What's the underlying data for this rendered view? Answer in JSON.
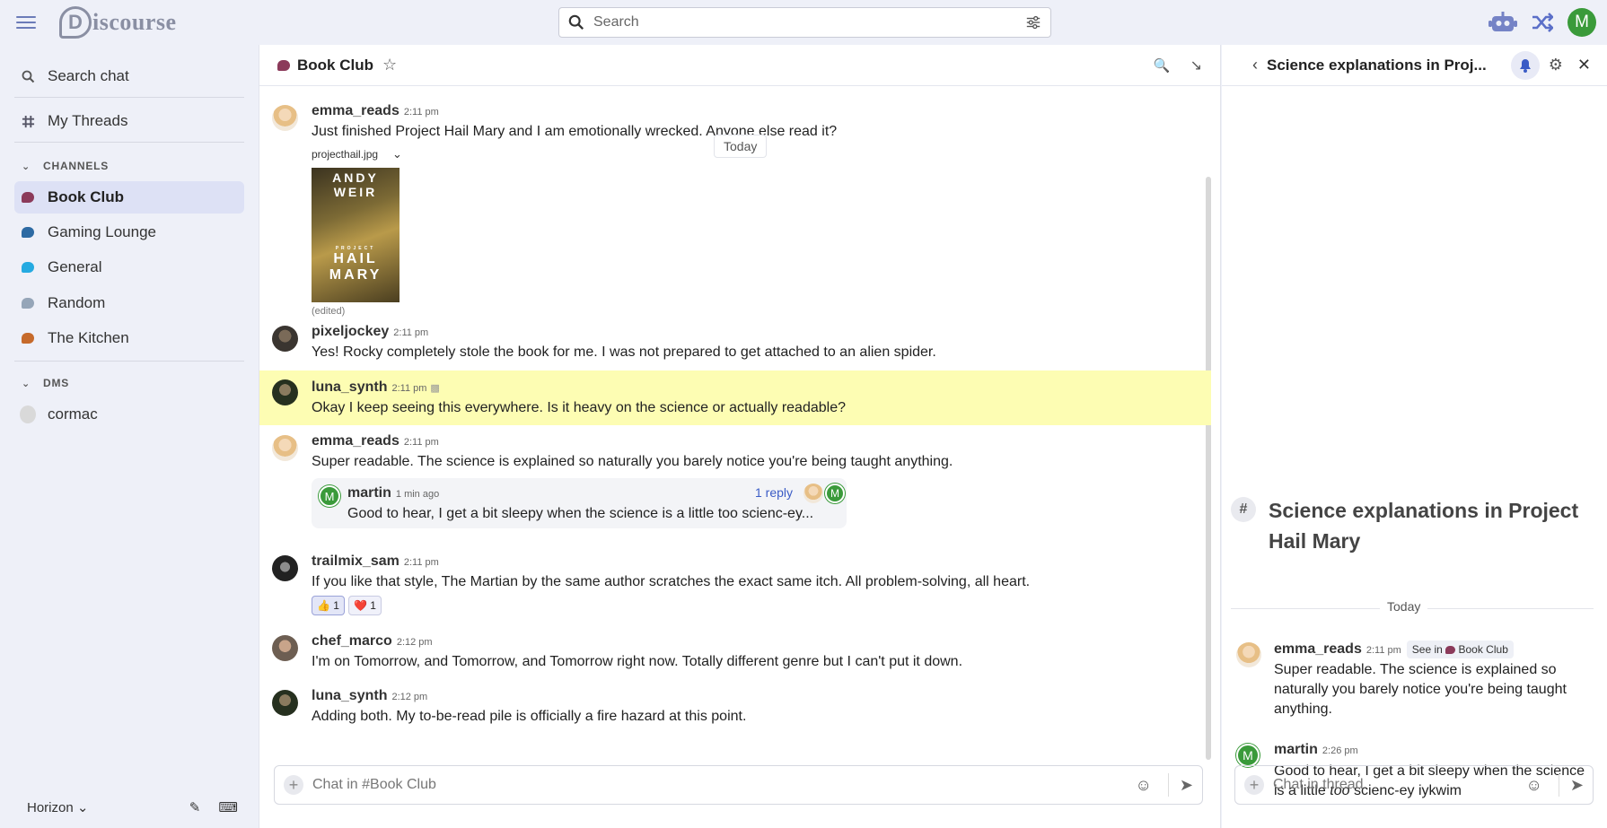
{
  "header": {
    "search_placeholder": "Search",
    "user_initial": "M"
  },
  "sidebar": {
    "search_chat": "Search chat",
    "my_threads": "My Threads",
    "channels_label": "CHANNELS",
    "channels": [
      {
        "label": "Book Club",
        "color": "#8b3a5a"
      },
      {
        "label": "Gaming Lounge",
        "color": "#2d6aa3"
      },
      {
        "label": "General",
        "color": "#25aae1"
      },
      {
        "label": "Random",
        "color": "#95a5b8"
      },
      {
        "label": "The Kitchen",
        "color": "#c66a2b"
      }
    ],
    "dms_label": "DMS",
    "dms": [
      {
        "label": "cormac"
      }
    ],
    "footer_theme": "Horizon"
  },
  "channel": {
    "title": "Book Club",
    "today": "Today",
    "messages": [
      {
        "user": "emma_reads",
        "time": "2:11 pm",
        "text": "Just finished Project Hail Mary and I am emotionally wrecked. Anyone else read it?",
        "attachment": "projecthail.jpg",
        "edited": "(edited)"
      },
      {
        "user": "pixeljockey",
        "time": "2:11 pm",
        "text": "Yes! Rocky completely stole the book for me. I was not prepared to get attached to an alien spider."
      },
      {
        "user": "luna_synth",
        "time": "2:11 pm",
        "text": "Okay I keep seeing this everywhere. Is it heavy on the science or actually readable?"
      },
      {
        "user": "emma_reads",
        "time": "2:11 pm",
        "text": "Super readable. The science is explained so naturally you barely notice you're being taught anything."
      },
      {
        "user": "trailmix_sam",
        "time": "2:11 pm",
        "text": "If you like that style, The Martian by the same author scratches the exact same itch. All problem-solving, all heart."
      },
      {
        "user": "chef_marco",
        "time": "2:12 pm",
        "text": "I'm on Tomorrow, and Tomorrow, and Tomorrow right now. Totally different genre but I can't put it down."
      },
      {
        "user": "luna_synth",
        "time": "2:12 pm",
        "text": "Adding both. My to-be-read pile is officially a fire hazard at this point."
      }
    ],
    "thread_preview": {
      "user": "martin",
      "time": "1 min ago",
      "text": "Good to hear, I get a bit sleepy when the science is a little too scienc-ey...",
      "replies": "1 reply"
    },
    "reactions": [
      {
        "emoji": "👍",
        "count": "1"
      },
      {
        "emoji": "❤️",
        "count": "1"
      }
    ],
    "composer_placeholder": "Chat in #Book Club",
    "book_cover": {
      "line1": "ANDY",
      "line2": "WEIR",
      "line3": "HAIL",
      "line4": "MARY",
      "small": "PROJECT"
    }
  },
  "thread": {
    "header_title": "Science explanations in Proj...",
    "big_title": "Science explanations in Project Hail Mary",
    "today": "Today",
    "see_in": "See in",
    "see_in_channel": "Book Club",
    "messages": [
      {
        "user": "emma_reads",
        "time": "2:11 pm",
        "text": "Super readable. The science is explained so naturally you barely notice you're being taught anything."
      },
      {
        "user": "martin",
        "time": "2:26 pm",
        "text_before": "Good to hear, I get a bit sleepy when the science is a little ",
        "text_em": "too",
        "text_after": " scienc-ey iykwim"
      }
    ],
    "composer_placeholder": "Chat in thread"
  }
}
